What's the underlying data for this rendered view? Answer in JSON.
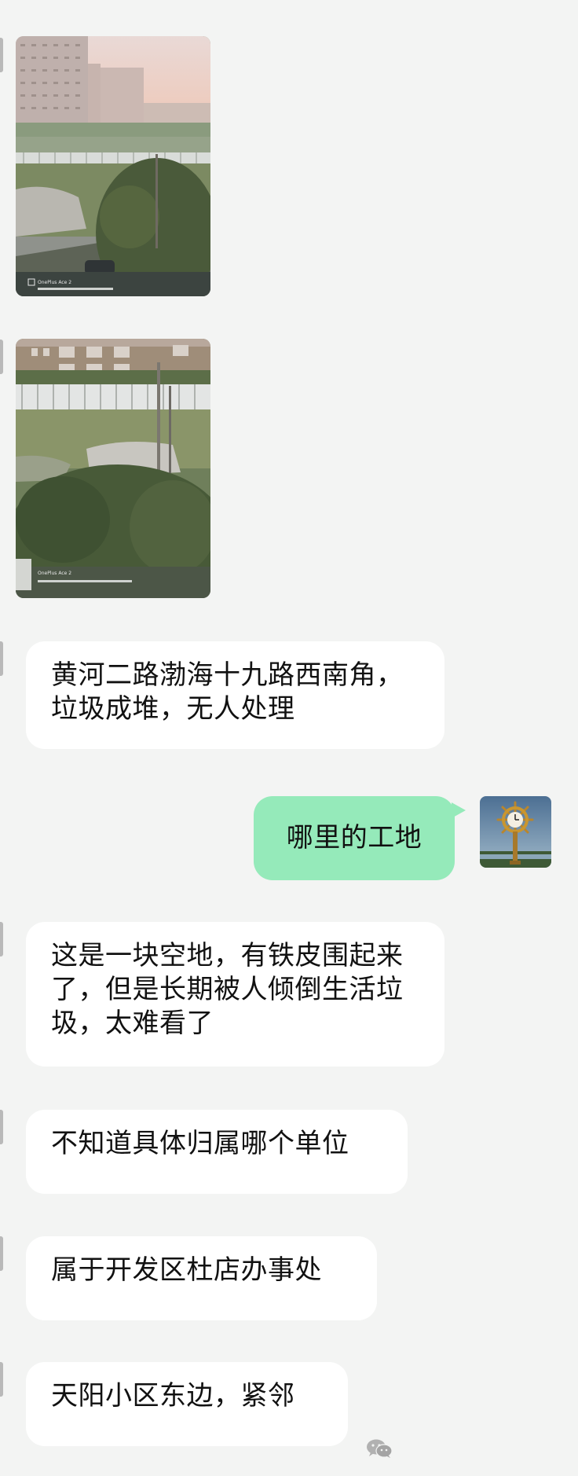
{
  "conversation": {
    "messages": [
      {
        "sender": "contact",
        "type": "image",
        "watermark": "OnePlus Ace 2"
      },
      {
        "sender": "contact",
        "type": "image",
        "watermark": "OnePlus Ace 2"
      },
      {
        "sender": "contact",
        "type": "text",
        "text": "黄河二路渤海十九路西南角，垃圾成堆，无人处理"
      },
      {
        "sender": "me",
        "type": "text",
        "text": "哪里的工地"
      },
      {
        "sender": "contact",
        "type": "text",
        "text": "这是一块空地，有铁皮围起来了，但是长期被人倾倒生活垃圾，太难看了"
      },
      {
        "sender": "contact",
        "type": "text",
        "text": "不知道具体归属哪个单位"
      },
      {
        "sender": "contact",
        "type": "text",
        "text": "属于开发区杜店办事处"
      },
      {
        "sender": "contact",
        "type": "text",
        "text": "天阳小区东边，紧邻"
      }
    ]
  },
  "colors": {
    "background": "#f3f4f3",
    "incoming_bubble": "#ffffff",
    "outgoing_bubble": "#95eaba"
  },
  "icons": [
    "photo-image",
    "avatar-clock-image",
    "wechat-logo-icon"
  ]
}
